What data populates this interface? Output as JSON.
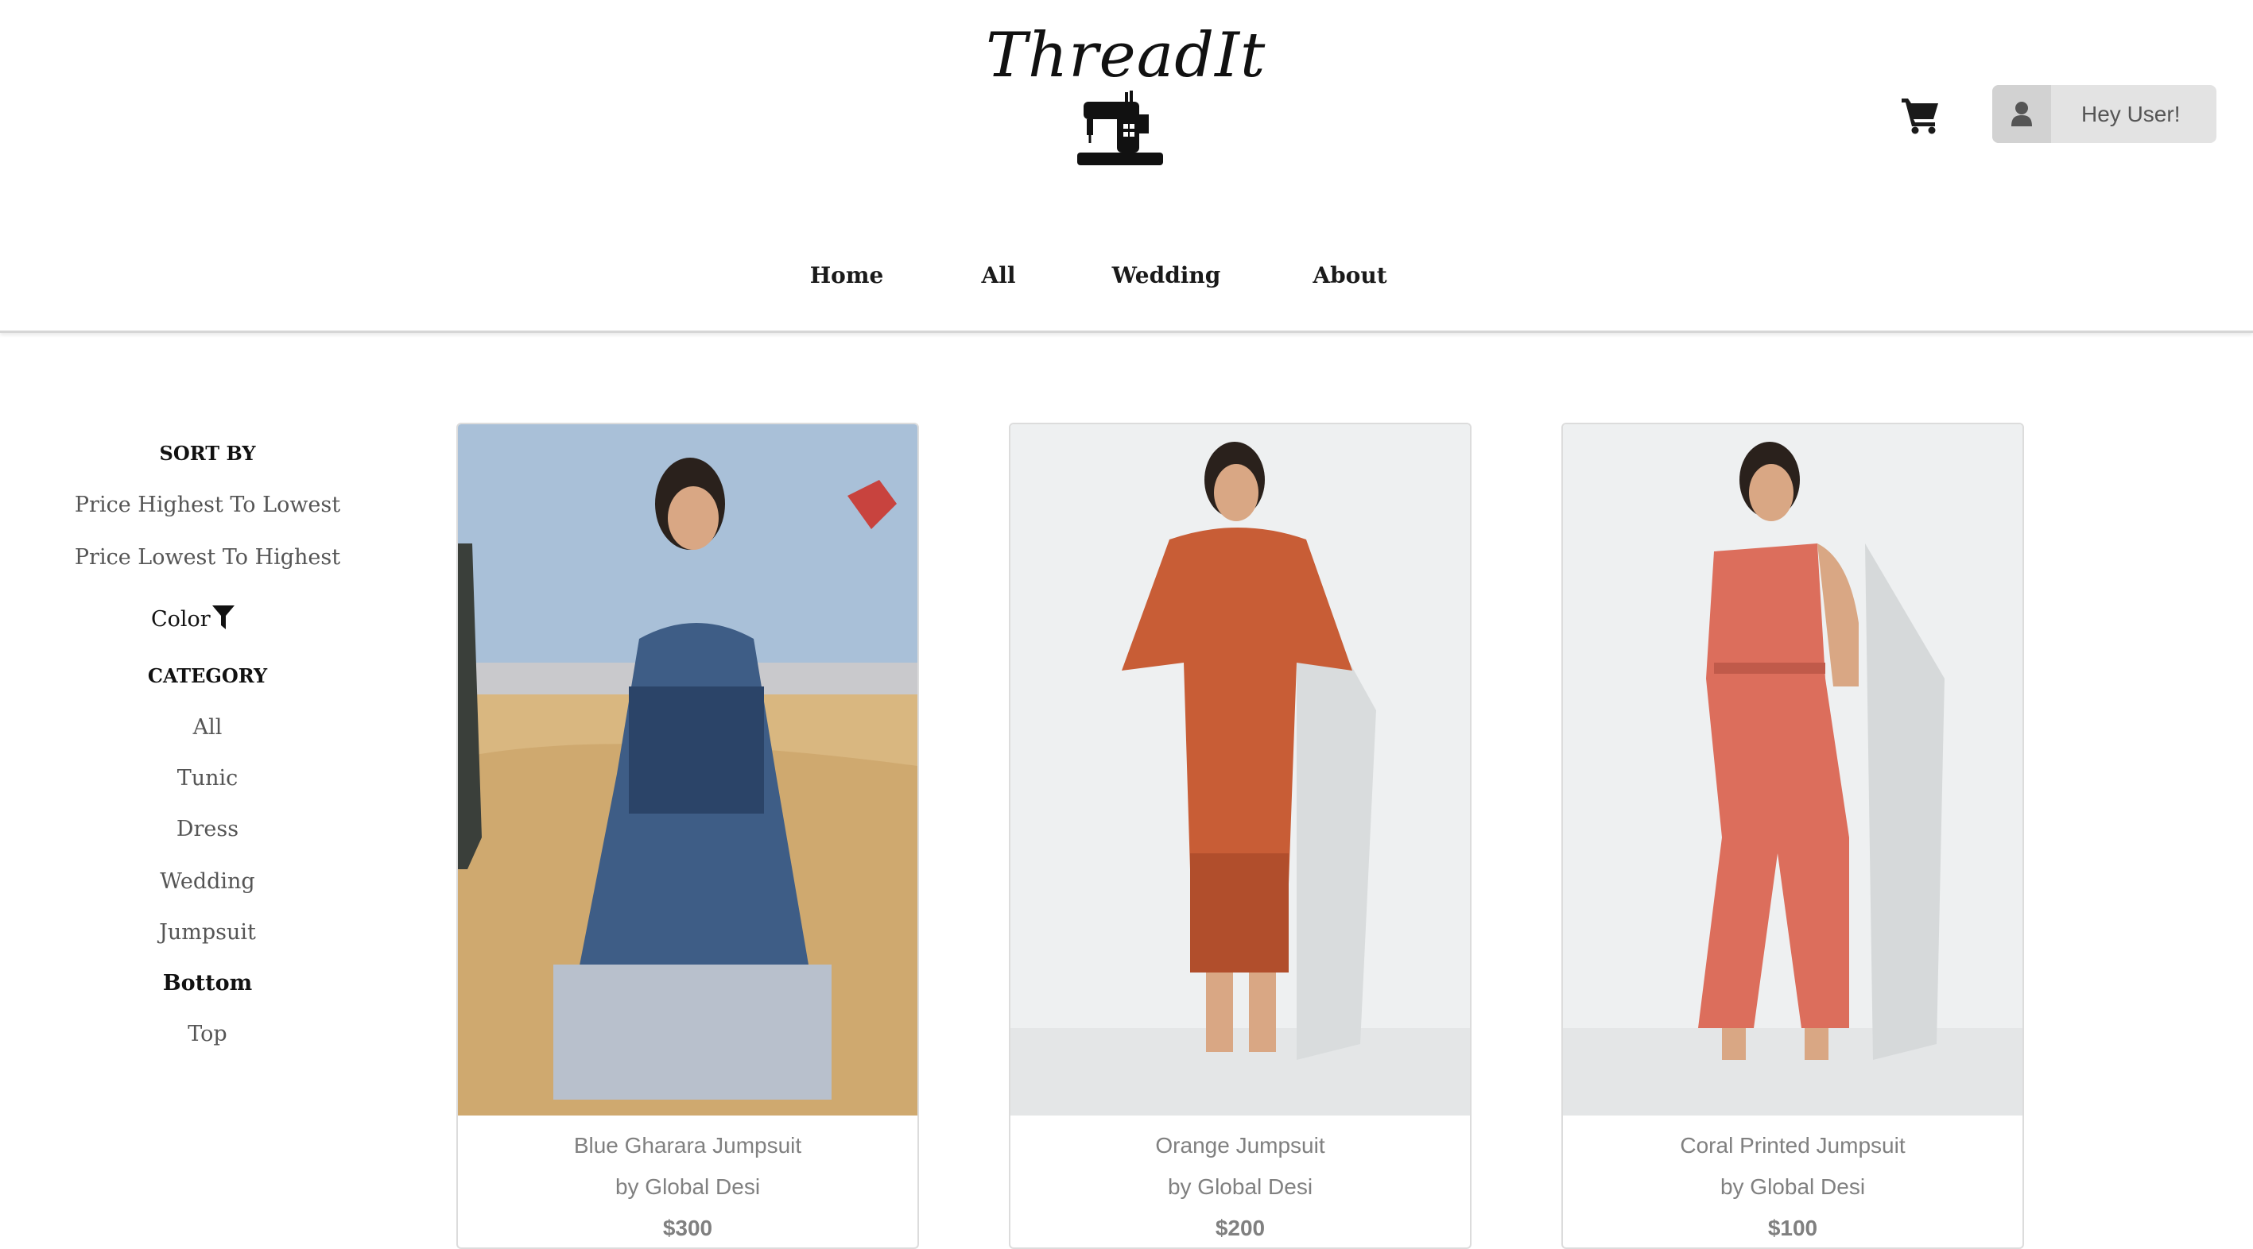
{
  "brand": {
    "name": "ThreadIt"
  },
  "header": {
    "user_greeting": "Hey User!"
  },
  "icons": {
    "cart": "cart-icon",
    "user": "user-icon",
    "filter": "filter-icon",
    "logo": "sewing-machine-icon"
  },
  "nav": {
    "items": [
      {
        "label": "Home"
      },
      {
        "label": "All"
      },
      {
        "label": "Wedding"
      },
      {
        "label": "About"
      }
    ]
  },
  "sidebar": {
    "sort_heading": "SORT BY",
    "sort_options": [
      "Price Highest To Lowest",
      "Price Lowest To Highest"
    ],
    "color_filter_label": "Color",
    "category_heading": "CATEGORY",
    "categories": [
      "All",
      "Tunic",
      "Dress",
      "Wedding",
      "Jumpsuit",
      "Bottom",
      "Top"
    ],
    "selected_category": "Bottom"
  },
  "products": [
    {
      "title": "Blue Gharara Jumpsuit",
      "brand": "by Global Desi",
      "price": "$300"
    },
    {
      "title": "Orange Jumpsuit",
      "brand": "by Global Desi",
      "price": "$200"
    },
    {
      "title": "Coral Printed Jumpsuit",
      "brand": "by Global Desi",
      "price": "$100"
    }
  ],
  "colors": {
    "nav_text": "#1a1a1a",
    "muted_text": "#808080",
    "user_button_bg": "#e3e3e3"
  }
}
